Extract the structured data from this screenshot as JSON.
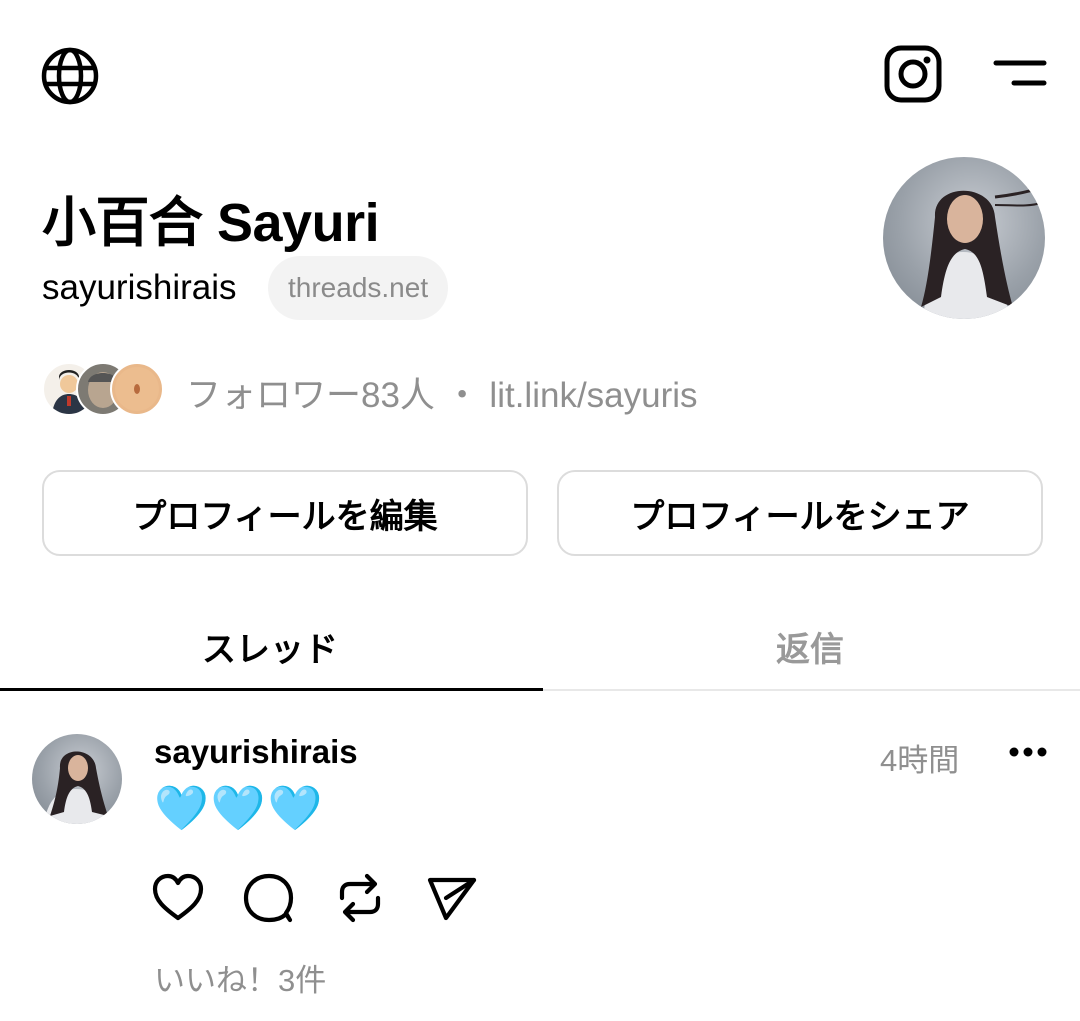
{
  "header": {
    "left_icon": "globe-icon",
    "right_icons": [
      "instagram-icon",
      "menu-icon"
    ]
  },
  "profile": {
    "display_name": "小百合 Sayuri",
    "username": "sayurishirais",
    "domain_badge": "threads.net",
    "followers_text": "フォロワー83人",
    "separator": "・",
    "link": "lit.link/sayuris",
    "avatar": "profile-photo"
  },
  "actions": {
    "edit_label": "プロフィールを編集",
    "share_label": "プロフィールをシェア"
  },
  "tabs": [
    {
      "label": "スレッド",
      "active": true
    },
    {
      "label": "返信",
      "active": false
    }
  ],
  "post": {
    "username": "sayurishirais",
    "time": "4時間",
    "body": "🩵🩵🩵",
    "likes": "いいね！3件",
    "action_icons": [
      "heart-icon",
      "comment-icon",
      "repost-icon",
      "send-icon"
    ]
  },
  "colors": {
    "text": "#000000",
    "muted": "#8f8f8f",
    "pill_bg": "#f3f3f3",
    "border": "#dcdcdc",
    "heart_emoji": "#55c6ef"
  }
}
